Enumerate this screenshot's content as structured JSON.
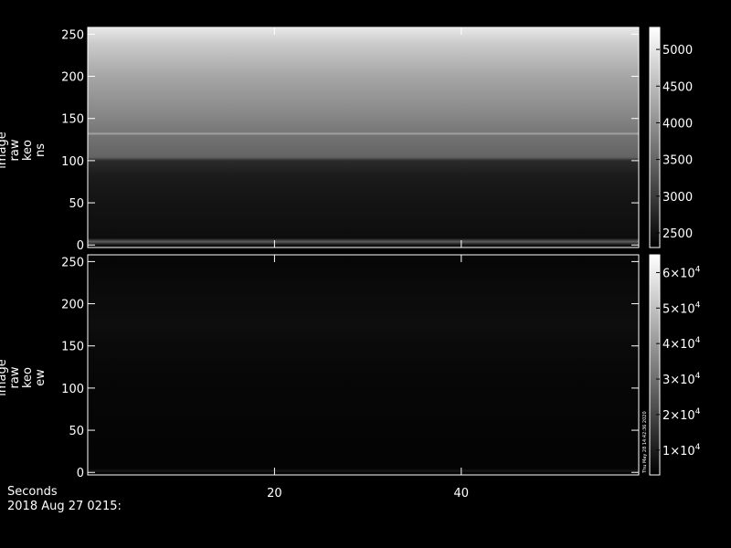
{
  "chart_data": [
    {
      "type": "heatmap",
      "ylabel_lines": [
        "image",
        "raw",
        "keo",
        "ns"
      ],
      "y_ticks": [
        0,
        50,
        100,
        150,
        200,
        250
      ],
      "ylim": [
        -3,
        258
      ],
      "xlim": [
        0,
        59
      ],
      "colorbar": {
        "range": [
          2300,
          5300
        ],
        "ticks": [
          {
            "value": 2500,
            "label": "2500"
          },
          {
            "value": 3000,
            "label": "3000"
          },
          {
            "value": 3500,
            "label": "3500"
          },
          {
            "value": 4000,
            "label": "4000"
          },
          {
            "value": 4500,
            "label": "4500"
          },
          {
            "value": 5000,
            "label": "5000"
          }
        ]
      },
      "row_intensity": [
        {
          "y": 0,
          "value": 2500
        },
        {
          "y": 4,
          "value": 3400
        },
        {
          "y": 8,
          "value": 2450
        },
        {
          "y": 20,
          "value": 2480
        },
        {
          "y": 50,
          "value": 2530
        },
        {
          "y": 80,
          "value": 2600
        },
        {
          "y": 100,
          "value": 2800
        },
        {
          "y": 104,
          "value": 3450
        },
        {
          "y": 108,
          "value": 3500
        },
        {
          "y": 130,
          "value": 3650
        },
        {
          "y": 132,
          "value": 4250
        },
        {
          "y": 134,
          "value": 3700
        },
        {
          "y": 150,
          "value": 3850
        },
        {
          "y": 200,
          "value": 4250
        },
        {
          "y": 240,
          "value": 4700
        },
        {
          "y": 256,
          "value": 5000
        }
      ]
    },
    {
      "type": "heatmap",
      "ylabel_lines": [
        "image",
        "raw",
        "keo",
        "ew"
      ],
      "y_ticks": [
        0,
        50,
        100,
        150,
        200,
        250
      ],
      "ylim": [
        -3,
        258
      ],
      "xlim": [
        0,
        59
      ],
      "colorbar": {
        "range": [
          3000,
          65000
        ],
        "ticks": [
          {
            "value": 10000,
            "mantissa": "1×10",
            "exp": "4"
          },
          {
            "value": 20000,
            "mantissa": "2×10",
            "exp": "4"
          },
          {
            "value": 30000,
            "mantissa": "3×10",
            "exp": "4"
          },
          {
            "value": 40000,
            "mantissa": "4×10",
            "exp": "4"
          },
          {
            "value": 50000,
            "mantissa": "5×10",
            "exp": "4"
          },
          {
            "value": 60000,
            "mantissa": "6×10",
            "exp": "4"
          }
        ]
      },
      "row_intensity": [
        {
          "y": 0,
          "value": 4500
        },
        {
          "y": 2,
          "value": 9000
        },
        {
          "y": 4,
          "value": 4000
        },
        {
          "y": 100,
          "value": 4400
        },
        {
          "y": 150,
          "value": 5500
        },
        {
          "y": 175,
          "value": 6500
        },
        {
          "y": 200,
          "value": 5800
        },
        {
          "y": 256,
          "value": 4500
        }
      ]
    }
  ],
  "x_axis": {
    "title": "Seconds",
    "ticks": [
      {
        "value": 20,
        "label": "20"
      },
      {
        "value": 40,
        "label": "40"
      }
    ]
  },
  "timestamp": "2018 Aug 27 0215:",
  "stamp_text": "Thu May 28 14:42:36 2020"
}
